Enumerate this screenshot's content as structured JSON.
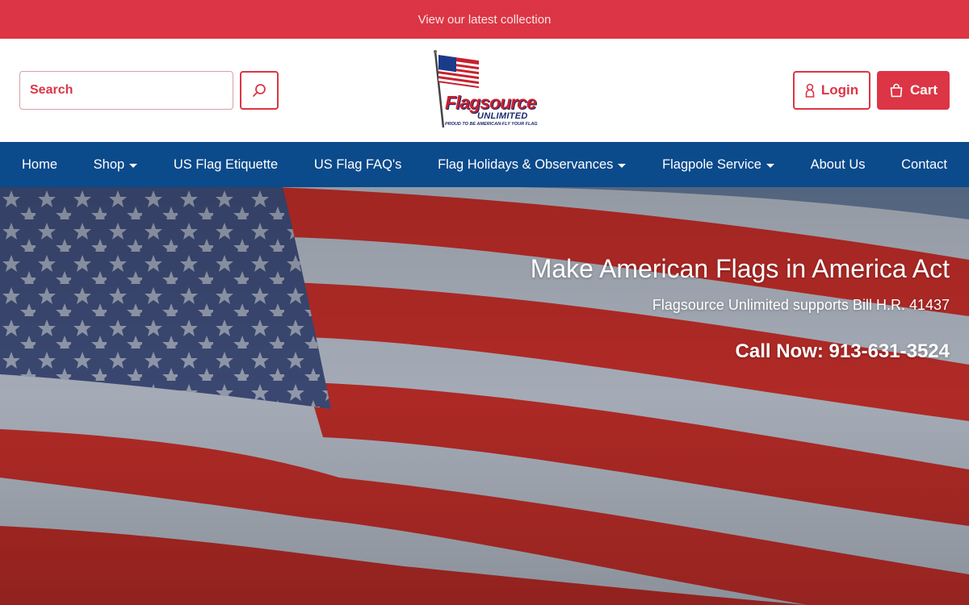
{
  "announcement": {
    "text": "View our latest collection"
  },
  "header": {
    "search": {
      "placeholder": "Search"
    },
    "logo": {
      "name": "Flagsource",
      "subname": "UNLIMITED",
      "tagline": "PROUD TO BE AMERICAN-FLY YOUR FLAG"
    },
    "login_label": "Login",
    "cart_label": "Cart"
  },
  "nav": {
    "items": [
      {
        "label": "Home",
        "dropdown": false
      },
      {
        "label": "Shop",
        "dropdown": true
      },
      {
        "label": "US Flag Etiquette",
        "dropdown": false
      },
      {
        "label": "US Flag FAQ's",
        "dropdown": false
      },
      {
        "label": "Flag Holidays & Observances",
        "dropdown": true
      },
      {
        "label": "Flagpole Service",
        "dropdown": true
      },
      {
        "label": "About Us",
        "dropdown": false
      },
      {
        "label": "Contact",
        "dropdown": false
      }
    ]
  },
  "hero": {
    "title": "Make American Flags in America Act",
    "subtitle": "Flagsource Unlimited supports Bill H.R. 41437",
    "cta": "Call Now: 913-631-3524"
  },
  "icons": {
    "search": "search-icon",
    "login": "user-icon",
    "cart": "shopping-bag-icon",
    "dropdown": "caret-down-icon"
  },
  "colors": {
    "accent": "#dc3545",
    "nav": "#0b4a8b",
    "white": "#ffffff"
  }
}
